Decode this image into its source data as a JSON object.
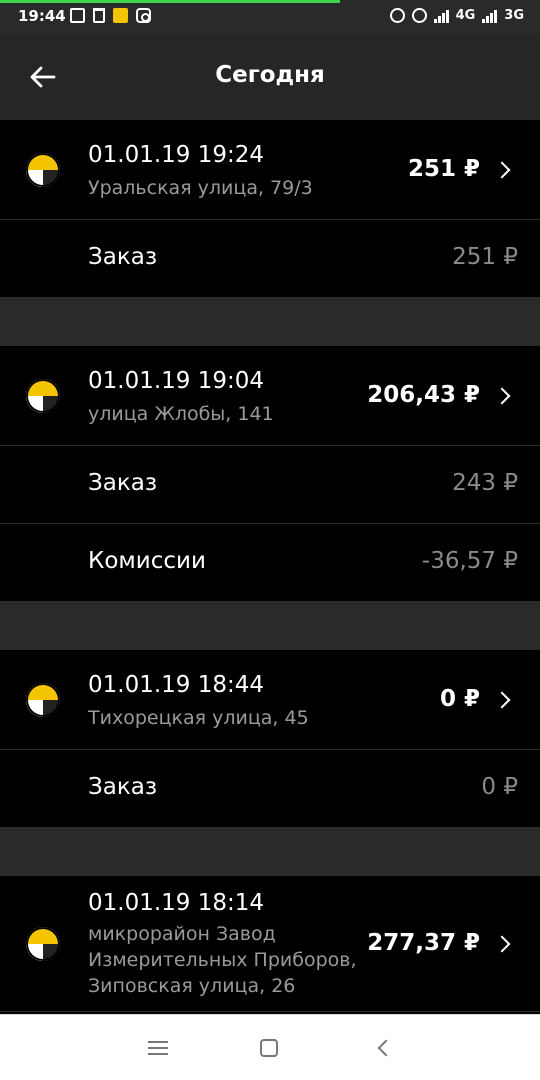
{
  "status_bar": {
    "time": "19:44",
    "network_1": "4G",
    "network_2": "3G"
  },
  "header": {
    "title": "Сегодня"
  },
  "orders": [
    {
      "datetime": "01.01.19 19:24",
      "address": "Уральская улица, 79/3",
      "amount": "251 ₽",
      "details": [
        {
          "label": "Заказ",
          "value": "251 ₽"
        }
      ]
    },
    {
      "datetime": "01.01.19 19:04",
      "address": "улица Жлобы, 141",
      "amount": "206,43 ₽",
      "details": [
        {
          "label": "Заказ",
          "value": "243 ₽"
        },
        {
          "label": "Комиссии",
          "value": "-36,57 ₽"
        }
      ]
    },
    {
      "datetime": "01.01.19 18:44",
      "address": "Тихорецкая улица, 45",
      "amount": "0 ₽",
      "details": [
        {
          "label": "Заказ",
          "value": "0 ₽"
        }
      ]
    },
    {
      "datetime": "01.01.19 18:14",
      "address": "микрорайон Завод Измерительных Приборов, Зиповская улица, 26",
      "amount": "277,37 ₽",
      "details": []
    }
  ],
  "colors": {
    "accent_yellow": "#f4c400",
    "header_bg": "#262626",
    "separator_bg": "#2a2a2a",
    "secondary_text": "#9a9a9a"
  }
}
